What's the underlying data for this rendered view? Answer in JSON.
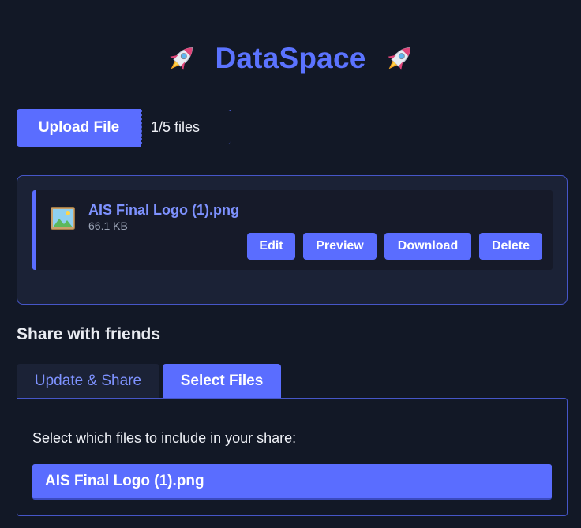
{
  "header": {
    "title": "DataSpace",
    "left_icon": "rocket-icon",
    "right_icon": "rocket-icon"
  },
  "upload": {
    "button_label": "Upload File",
    "file_count": "1/5 files"
  },
  "files": [
    {
      "icon": "image-file-icon",
      "name": "AIS Final Logo (1).png",
      "size": "66.1 KB",
      "actions": [
        "Edit",
        "Preview",
        "Download",
        "Delete"
      ]
    }
  ],
  "share": {
    "heading": "Share with friends",
    "tabs": [
      {
        "label": "Update & Share",
        "active": false
      },
      {
        "label": "Select Files",
        "active": true
      }
    ],
    "instruction": "Select which files to include in your share:",
    "options": [
      {
        "label": "AIS Final Logo (1).png",
        "selected": true
      }
    ]
  },
  "colors": {
    "background": "#121826",
    "accent": "#5a6dff",
    "title": "#5b73ff",
    "link": "#7e92ff",
    "panel": "#1b2236",
    "border": "#4656c8"
  }
}
